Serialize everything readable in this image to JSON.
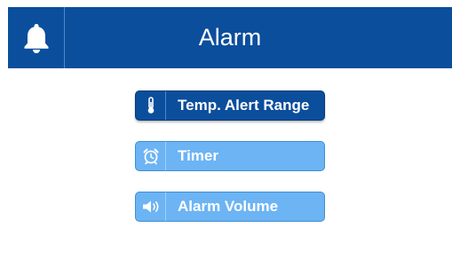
{
  "header": {
    "title": "Alarm",
    "icon": "bell-icon"
  },
  "menu": [
    {
      "label": "Temp. Alert Range",
      "icon": "thermometer-icon",
      "active": true
    },
    {
      "label": "Timer",
      "icon": "alarm-clock-icon",
      "active": false
    },
    {
      "label": "Alarm Volume",
      "icon": "speaker-icon",
      "active": false
    }
  ],
  "colors": {
    "header_bg": "#0b4e9c",
    "button_active": "#0b4e9c",
    "button_inactive": "#6cb4f4",
    "text": "#ffffff"
  }
}
